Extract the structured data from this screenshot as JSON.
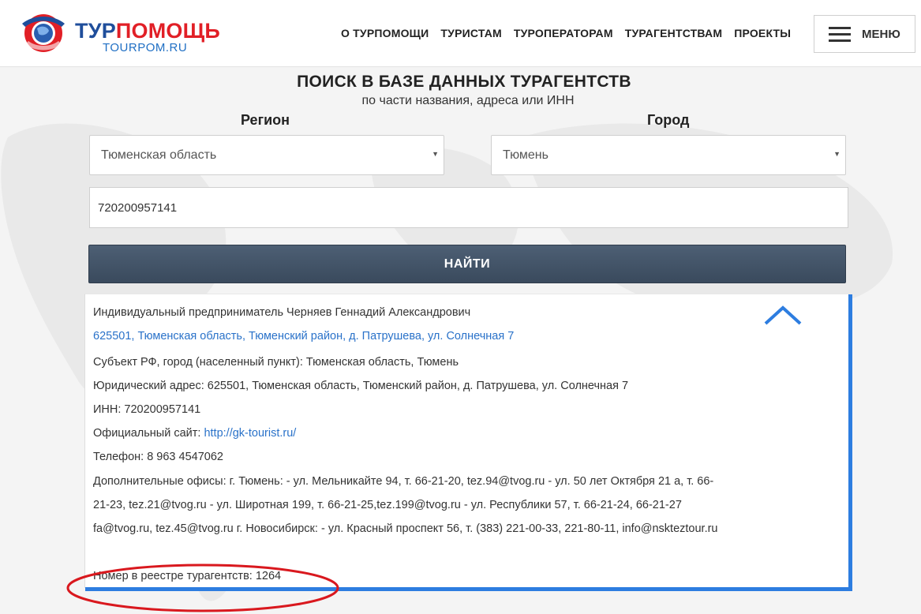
{
  "header": {
    "logo": {
      "part1": "ТУР",
      "part2": "ПОМОЩЬ",
      "sub": "TOURPOM.RU"
    },
    "nav": [
      "О ТУРПОМОЩИ",
      "ТУРИСТАМ",
      "ТУРОПЕРАТОРАМ",
      "ТУРАГЕНТСТВАМ",
      "ПРОЕКТЫ"
    ],
    "menu_label": "МЕНЮ"
  },
  "search": {
    "title": "ПОИСК В БАЗЕ ДАННЫХ ТУРАГЕНТСТВ",
    "subtitle": "по части названия, адреса или ИНН",
    "region_label": "Регион",
    "city_label": "Город",
    "region_value": "Тюменская область",
    "city_value": "Тюмень",
    "query_value": "720200957141",
    "button_label": "НАЙТИ"
  },
  "result": {
    "name": "Индивидуальный предприниматель Черняев Геннадий Александрович",
    "address_link": "625501, Тюменская область, Тюменский район, д. Патрушева, ул. Солнечная 7",
    "subject": "Субъект РФ, город (населенный пункт): Тюменская область, Тюмень",
    "legal_address": "Юридический адрес: 625501, Тюменская область, Тюменский район, д. Патрушева, ул. Солнечная 7",
    "inn": "ИНН: 720200957141",
    "site_label": "Официальный сайт: ",
    "site_url": "http://gk-tourist.ru/",
    "phone": "Телефон: 8 963 4547062",
    "offices": "Дополнительные офисы: г. Тюмень: - ул. Мельникайте 94, т. 66-21-20, tez.94@tvog.ru - ул. 50 лет Октября 21 а, т. 66-21-23, tez.21@tvog.ru - ул. Широтная 199, т. 66-21-25,tez.199@tvog.ru - ул. Республики 57, т. 66-21-24, 66-21-27 fa@tvog.ru, tez.45@tvog.ru г. Новосибирск: - ул. Красный проспект 56, т. (383) 221-00-33, 221-80-11, info@nskteztour.ru",
    "registry": "Номер в реестре турагентств: 1264"
  },
  "colors": {
    "brand_blue": "#1f4e9b",
    "brand_red": "#e11f26",
    "accent": "#2d7de0",
    "button": "#3f5063",
    "annotation": "#d9181e"
  },
  "icons": [
    "logo-globe-icon",
    "burger-menu-icon",
    "chevron-up-icon",
    "select-caret-icon"
  ]
}
